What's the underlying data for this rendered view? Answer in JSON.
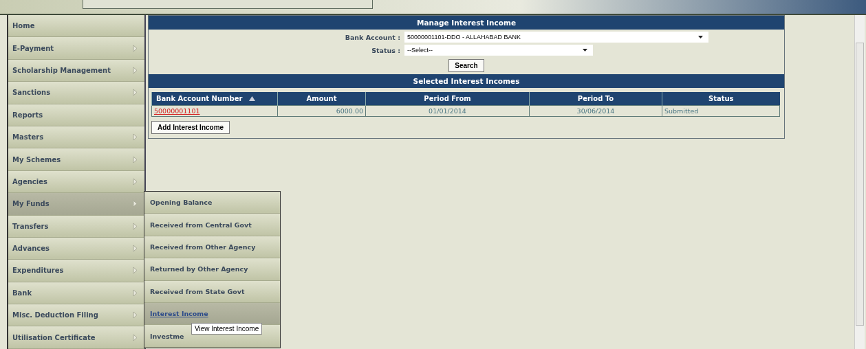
{
  "sidebar": {
    "items": [
      {
        "label": "Home",
        "has_submenu": false,
        "selected": false
      },
      {
        "label": "E-Payment",
        "has_submenu": true,
        "selected": false
      },
      {
        "label": "Scholarship Management",
        "has_submenu": true,
        "selected": false
      },
      {
        "label": "Sanctions",
        "has_submenu": true,
        "selected": false
      },
      {
        "label": "Reports",
        "has_submenu": false,
        "selected": false
      },
      {
        "label": "Masters",
        "has_submenu": true,
        "selected": false
      },
      {
        "label": "My Schemes",
        "has_submenu": true,
        "selected": false
      },
      {
        "label": "Agencies",
        "has_submenu": true,
        "selected": false
      },
      {
        "label": "My Funds",
        "has_submenu": true,
        "selected": true
      },
      {
        "label": "Transfers",
        "has_submenu": true,
        "selected": false
      },
      {
        "label": "Advances",
        "has_submenu": true,
        "selected": false
      },
      {
        "label": "Expenditures",
        "has_submenu": true,
        "selected": false
      },
      {
        "label": "Bank",
        "has_submenu": true,
        "selected": false
      },
      {
        "label": "Misc. Deduction Filing",
        "has_submenu": true,
        "selected": false
      },
      {
        "label": "Utilisation Certificate",
        "has_submenu": true,
        "selected": false
      }
    ]
  },
  "submenu": {
    "items": [
      {
        "label": "Opening Balance",
        "selected": false
      },
      {
        "label": "Received from Central Govt",
        "selected": false
      },
      {
        "label": "Received from Other Agency",
        "selected": false
      },
      {
        "label": "Returned by Other Agency",
        "selected": false
      },
      {
        "label": "Received from State Govt",
        "selected": false
      },
      {
        "label": "Interest Income",
        "selected": true
      },
      {
        "label": "Investme",
        "selected": false
      }
    ]
  },
  "tooltip": "View Interest Income",
  "form": {
    "title": "Manage Interest Income",
    "fields": [
      {
        "label": "Bank Account :",
        "value": "50000001101-DDO - ALLAHABAD BANK",
        "kind": "wide"
      },
      {
        "label": "Status :",
        "value": "--Select--",
        "kind": "narrow"
      }
    ],
    "search_button": "Search"
  },
  "results": {
    "title": "Selected Interest Incomes",
    "columns": [
      {
        "label": "Bank Account Number",
        "sorted": true
      },
      {
        "label": "Amount",
        "sorted": false
      },
      {
        "label": "Period From",
        "sorted": false
      },
      {
        "label": "Period To",
        "sorted": false
      },
      {
        "label": "Status",
        "sorted": false
      }
    ],
    "rows": [
      {
        "cells": [
          "50000001101",
          "6000.00",
          "01/01/2014",
          "30/06/2014",
          "Submitted"
        ]
      }
    ],
    "add_button": "Add Interest Income"
  }
}
